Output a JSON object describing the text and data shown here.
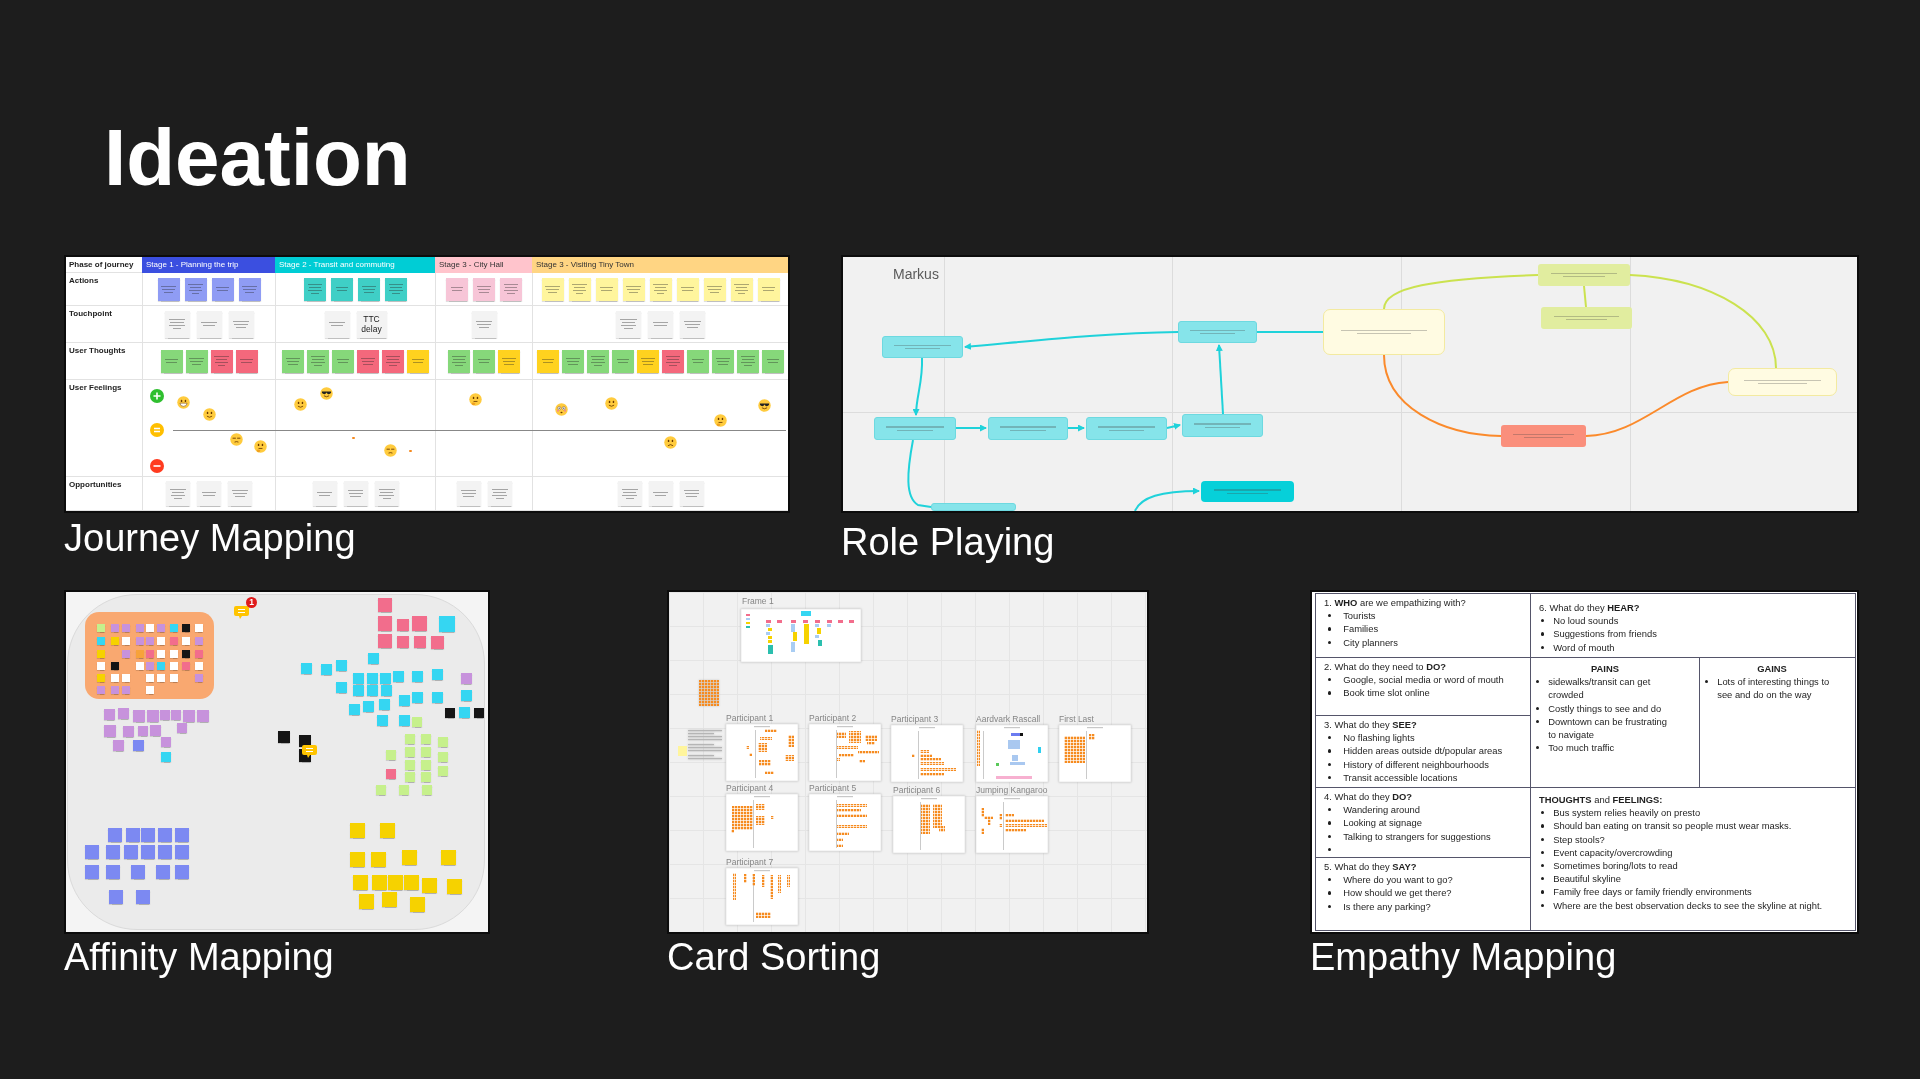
{
  "title": "Ideation",
  "journey_mapping": {
    "caption": "Journey Mapping",
    "phase_label": "Phase of journey",
    "row_labels": [
      "Actions",
      "Touchpoint",
      "User Thoughts",
      "User Feelings",
      "Opportunities"
    ],
    "stages": [
      {
        "title": "Stage 1 - Planning the trip",
        "color": "#3b4fe0",
        "actions": [
          {
            "color": "#8f9cf4"
          },
          {
            "color": "#8f9cf4"
          },
          {
            "color": "#8f9cf4"
          },
          {
            "color": "#8f9cf4"
          }
        ],
        "touchpoints": [
          {
            "color": "#f3f3f3"
          },
          {
            "color": "#f3f3f3"
          },
          {
            "color": "#f3f3f3"
          }
        ],
        "thoughts": [
          {
            "color": "#86d87a"
          },
          {
            "color": "#86d87a"
          },
          {
            "color": "#f4687c"
          },
          {
            "color": "#f4687c"
          }
        ],
        "opportunities": [
          {
            "color": "#f3f3f3"
          },
          {
            "color": "#f3f3f3"
          },
          {
            "color": "#f3f3f3"
          }
        ]
      },
      {
        "title": "Stage 2 - Transit and commuting",
        "color": "#00cdd5",
        "actions": [
          {
            "color": "#3fcfc6"
          },
          {
            "color": "#3fcfc6"
          },
          {
            "color": "#3fcfc6"
          },
          {
            "color": "#3fcfc6"
          }
        ],
        "touchpoints": [
          {
            "color": "#f3f3f3"
          },
          {
            "color": "#f3f3f3",
            "text": "TTC delay"
          }
        ],
        "thoughts": [
          {
            "color": "#86d87a"
          },
          {
            "color": "#86d87a"
          },
          {
            "color": "#86d87a"
          },
          {
            "color": "#f4687c"
          },
          {
            "color": "#f4687c"
          },
          {
            "color": "#ffd21f"
          }
        ],
        "opportunities": [
          {
            "color": "#f3f3f3"
          },
          {
            "color": "#f3f3f3"
          },
          {
            "color": "#f3f3f3"
          }
        ]
      },
      {
        "title": "Stage 3 - City Hall",
        "color": "#ffc4cc",
        "actions": [
          {
            "color": "#f7c5d7"
          },
          {
            "color": "#f7c5d7"
          },
          {
            "color": "#f7c5d7"
          }
        ],
        "touchpoints": [
          {
            "color": "#f3f3f3"
          }
        ],
        "thoughts": [
          {
            "color": "#86d87a"
          },
          {
            "color": "#86d87a"
          },
          {
            "color": "#ffd21f"
          }
        ],
        "opportunities": [
          {
            "color": "#f3f3f3"
          },
          {
            "color": "#f3f3f3"
          }
        ]
      },
      {
        "title": "Stage 3 - Visiting Tiny Town",
        "color": "#ffd583",
        "actions": [
          {
            "color": "#fff59d"
          },
          {
            "color": "#fff59d"
          },
          {
            "color": "#fff59d"
          },
          {
            "color": "#fff59d"
          },
          {
            "color": "#fff59d"
          },
          {
            "color": "#fff59d"
          },
          {
            "color": "#fff59d"
          },
          {
            "color": "#fff59d"
          },
          {
            "color": "#fff59d"
          }
        ],
        "touchpoints": [
          {
            "color": "#f3f3f3"
          },
          {
            "color": "#f3f3f3"
          },
          {
            "color": "#f3f3f3"
          }
        ],
        "thoughts": [
          {
            "color": "#ffd21f"
          },
          {
            "color": "#86d87a"
          },
          {
            "color": "#86d87a"
          },
          {
            "color": "#86d87a"
          },
          {
            "color": "#ffd21f"
          },
          {
            "color": "#f4687c"
          },
          {
            "color": "#86d87a"
          },
          {
            "color": "#86d87a"
          },
          {
            "color": "#86d87a"
          },
          {
            "color": "#86d87a"
          }
        ],
        "opportunities": [
          {
            "color": "#f3f3f3"
          },
          {
            "color": "#f3f3f3"
          },
          {
            "color": "#f3f3f3"
          }
        ]
      }
    ]
  },
  "role_playing": {
    "caption": "Role Playing",
    "persona": "Markus"
  },
  "affinity_mapping": {
    "caption": "Affinity Mapping",
    "comment_badge": "1"
  },
  "card_sorting": {
    "caption": "Card Sorting",
    "frame_label": "Frame 1",
    "board_labels": [
      "Participant 1",
      "Participant 2",
      "Participant 3",
      "Aardvark Rascall",
      "First Last",
      "Participant 4",
      "Participant 5",
      "Participant 6",
      "Jumping Kangaroo",
      "Participant 7"
    ]
  },
  "empathy_mapping": {
    "caption": "Empathy Mapping",
    "sections": [
      {
        "heading": "1. **WHO** are we empathizing with?",
        "items": [
          "Tourists",
          "Families",
          "City planners"
        ]
      },
      {
        "heading": "2. What do they need to **DO?**",
        "items": [
          "Google, social media or word of mouth",
          "Book time slot online"
        ]
      },
      {
        "heading": "3. What do they **SEE?**",
        "items": [
          "No flashing lights",
          "Hidden areas outside dt/popular areas",
          "History of different neighbourhoods",
          "Transit accessible locations"
        ]
      },
      {
        "heading": "4. What do they **DO?**",
        "items": [
          "Wandering around",
          "Looking at signage",
          "Talking to strangers for suggestions"
        ],
        "blank_bullet": true
      },
      {
        "heading": "5. What do they **SAY?**",
        "items": [
          "Where do you want to go?",
          "How should we get there?",
          "Is there any parking?"
        ]
      },
      {
        "heading": "6. What do they **HEAR?**",
        "items": [
          "No loud sounds",
          "Suggestions from friends",
          "Word of mouth"
        ]
      },
      {
        "heading": "PAINS",
        "items": [
          "sidewalks/transit can get crowded",
          "Costly things to see and do",
          "Downtown can be frustrating to navigate",
          "Too much traffic"
        ]
      },
      {
        "heading": "GAINS",
        "items": [
          "Lots of interesting things to see and do on the way"
        ]
      },
      {
        "heading": "**THOUGHTS** and **FEELINGS:**",
        "items": [
          "Bus system relies heavily on presto",
          "Should ban eating on transit so people must wear masks.",
          "Step stools?",
          "Event capacity/overcrowding",
          "Sometimes boring/lots to read",
          "Beautiful skyline",
          "Family free days or family friendly environments",
          "Where are the best observation decks to see the skyline at night."
        ]
      }
    ]
  }
}
